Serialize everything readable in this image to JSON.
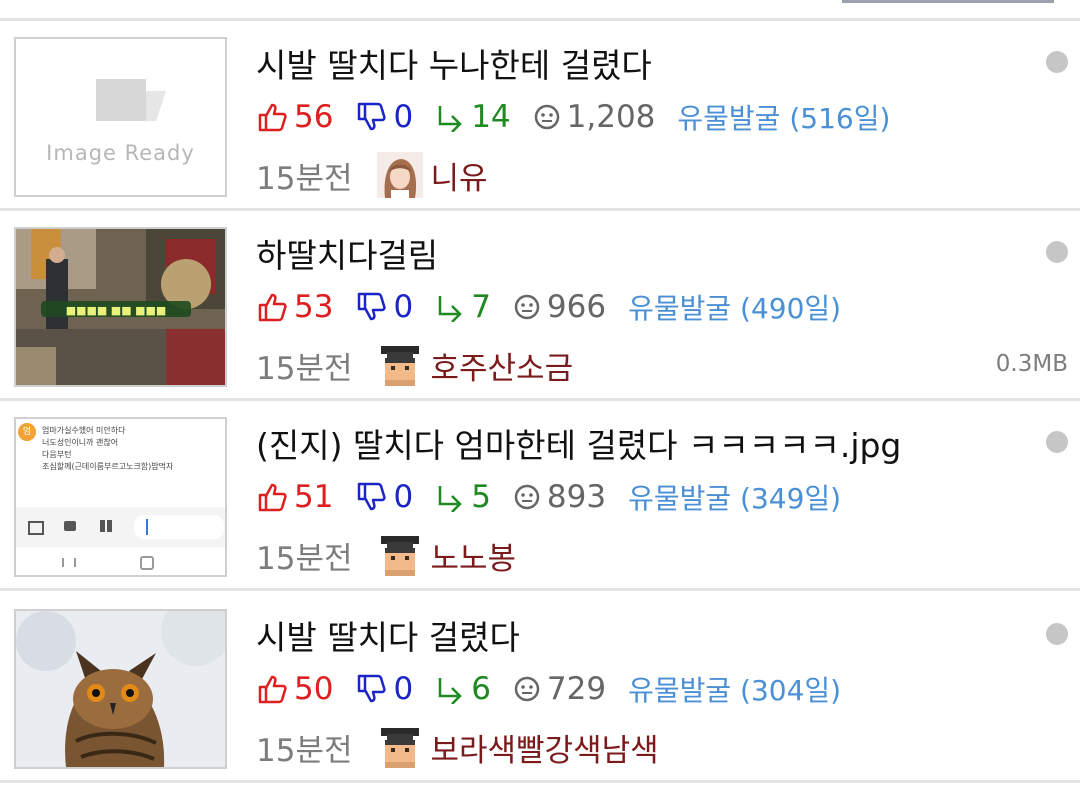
{
  "colors": {
    "up": "#dd1f1f",
    "down": "#1b24c8",
    "reply": "#1f8a22",
    "category": "#4b8fd6",
    "author": "#7b1a1a",
    "meta": "#7d7d7d"
  },
  "posts": [
    {
      "title": "시발 딸치다 누나한테 걸렸다",
      "likes": "56",
      "dislikes": "0",
      "replies": "14",
      "views": "1,208",
      "category": "유물발굴 (516일)",
      "time": "15분전",
      "author": "니유",
      "avatar": "girl-photo-avatar",
      "thumbnail_text": "Image Ready",
      "file_size": ""
    },
    {
      "title": "하딸치다걸림",
      "likes": "53",
      "dislikes": "0",
      "replies": "7",
      "views": "966",
      "category": "유물발굴 (490일)",
      "time": "15분전",
      "author": "호주산소금",
      "avatar": "pixel-graduate-avatar",
      "thumbnail_text": "",
      "file_size": "0.3MB"
    },
    {
      "title": "(진지) 딸치다 엄마한테 걸렸다 ㅋㅋㅋㅋㅋ.jpg",
      "likes": "51",
      "dislikes": "0",
      "replies": "5",
      "views": "893",
      "category": "유물발굴 (349일)",
      "time": "15분전",
      "author": "노노봉",
      "avatar": "pixel-graduate-avatar",
      "thumbnail_text": "",
      "file_size": "",
      "thumbnail_lines": [
        "엄마가실수했어 미안하다",
        "너도성인이니까 괜찮어",
        "다음부턴",
        "조심할께(근데이름부르고노크함)밥먹자"
      ],
      "thumbnail_badge": "엄"
    },
    {
      "title": "시발 딸치다 걸렸다",
      "likes": "50",
      "dislikes": "0",
      "replies": "6",
      "views": "729",
      "category": "유물발굴 (304일)",
      "time": "15분전",
      "author": "보라색빨강색남색",
      "avatar": "pixel-graduate-avatar",
      "thumbnail_text": "",
      "file_size": ""
    }
  ]
}
